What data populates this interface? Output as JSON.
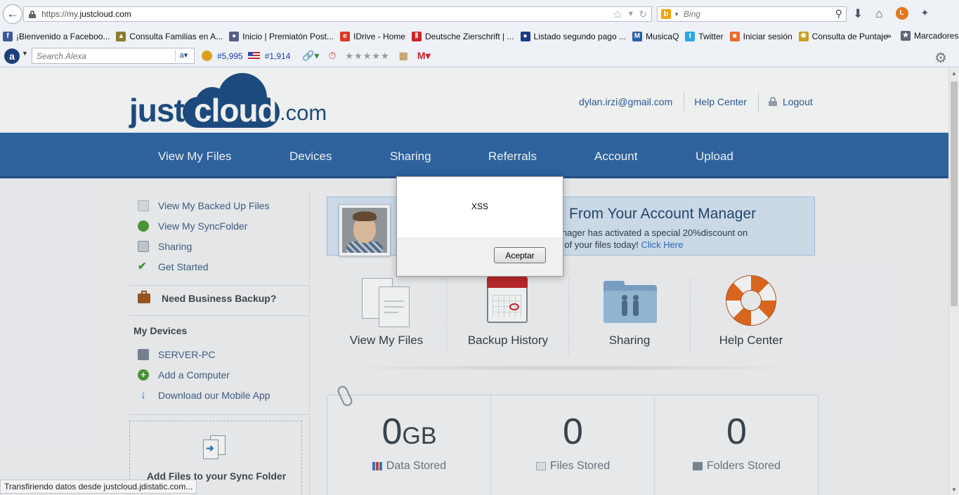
{
  "browser": {
    "url_prefix": "https://my.",
    "url_domain": "justcloud.com",
    "search_placeholder": "Bing",
    "bookmarks": [
      {
        "label": "¡Bienvenido a Faceboo...",
        "color": "#3b5998",
        "glyph": "f"
      },
      {
        "label": "Consulta Familias en A...",
        "color": "#8a7b2f",
        "glyph": "▲"
      },
      {
        "label": "Inicio | Premiatón Post...",
        "color": "#555f8a",
        "glyph": "●"
      },
      {
        "label": "IDrive - Home",
        "color": "#d93b26",
        "glyph": "e"
      },
      {
        "label": "Deutsche Zierschrift | ...",
        "color": "#c9252b",
        "glyph": "Ⅱ"
      },
      {
        "label": "Listado segundo pago ...",
        "color": "#1b3b88",
        "glyph": "●"
      },
      {
        "label": "MusicaQ",
        "color": "#2a5fa8",
        "glyph": "M"
      },
      {
        "label": "Twitter",
        "color": "#2ca7e0",
        "glyph": "t"
      },
      {
        "label": "Iniciar sesión",
        "color": "#e96b2c",
        "glyph": "■"
      },
      {
        "label": "Consulta de Puntaje",
        "color": "#caa021",
        "glyph": "✹"
      }
    ],
    "bookmarks_more": "»",
    "bookmarks_folder": "Marcadores",
    "alexa": {
      "search_placeholder": "Search Alexa",
      "rank_global": "#5,995",
      "rank_country": "#1,914"
    },
    "status_text": "Transfiriendo datos desde justcloud.jdistatic.com..."
  },
  "site": {
    "logo": {
      "just": "just",
      "cloud": "cloud",
      "com": ".com"
    },
    "header_links": {
      "email": "dylan.irzi@gmail.com",
      "help": "Help Center",
      "logout": "Logout"
    },
    "nav": [
      "View My Files",
      "Devices",
      "Sharing",
      "Referrals",
      "Account",
      "Upload"
    ],
    "sidebar": {
      "links": [
        {
          "label": "View My Backed Up Files",
          "color": "#c5ccd4"
        },
        {
          "label": "View My SyncFolder",
          "color": "#4f9a3a"
        },
        {
          "label": "Sharing",
          "color": "#9aa5b2"
        },
        {
          "label": "Get Started",
          "color": "#3d9a3d"
        }
      ],
      "business": "Need Business Backup?",
      "devices_heading": "My Devices",
      "devices": [
        {
          "label": "SERVER-PC",
          "color": "#7b8796"
        },
        {
          "label": "Add a Computer",
          "color": "#4f9a3a"
        },
        {
          "label": "Download our Mobile App",
          "color": "#3178c6"
        }
      ],
      "sync_box": "Add Files to your Sync Folder"
    },
    "promo": {
      "title": "From Your Account Manager",
      "text": "unt manager has activated a special 20%discount on",
      "text2": "he rest of your files today!",
      "link": "Click Here"
    },
    "tiles": [
      "View My Files",
      "Backup History",
      "Sharing",
      "Help Center"
    ],
    "stats": [
      {
        "value": "0",
        "unit": "GB",
        "label": "Data Stored"
      },
      {
        "value": "0",
        "unit": "",
        "label": "Files Stored"
      },
      {
        "value": "0",
        "unit": "",
        "label": "Folders Stored"
      }
    ]
  },
  "dialog": {
    "message": "XSS",
    "button": "Aceptar"
  }
}
